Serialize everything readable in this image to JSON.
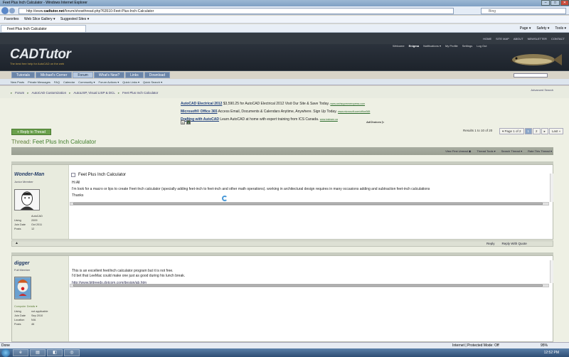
{
  "window": {
    "title": "Feet Plus Inch Calculator - Windows Internet Explorer",
    "address_prefix": "http://www.",
    "address_domain": "cadtutor.net",
    "address_path": "/forum/showthread.php?63510-Feet-Plus-Inch-Calculator",
    "search_placeholder": "Bing"
  },
  "favorites_bar": {
    "favorites": "Favorites",
    "web_slice": "Web Slice Gallery ▾",
    "suggested": "Suggested Sites ▾"
  },
  "tab": {
    "label": "Feet Plus Inch Calculator"
  },
  "command_bar": [
    "Page ▾",
    "Safety ▾",
    "Tools ▾"
  ],
  "site": {
    "top_links": [
      "HOME",
      "SITE MAP",
      "ABOUT",
      "NEWSLETTER",
      "CONTACT"
    ],
    "logo": "CADTutor",
    "tagline": "The best free help for AutoCAD on the web",
    "welcome": "Welcome",
    "user": "Enigma",
    "user_links": [
      "Notifications ▾",
      "My Profile",
      "Settings",
      "Log Out"
    ],
    "nav_tabs": [
      "Tutorials",
      "Michael's Corner",
      "Forum",
      "What's New?",
      "Links",
      "Download"
    ],
    "sub_nav": [
      "New Posts",
      "Private Messages",
      "FAQ",
      "Calendar",
      "Community ▾",
      "Forum Actions ▾",
      "Quick Links ▾",
      "Quick Search ▾"
    ],
    "advanced_search": "Advanced Search"
  },
  "breadcrumb": [
    "Forum",
    "AutoCAD Customization",
    "AutoLISP, Visual LISP & DCL",
    "Feet Plus Inch Calculator"
  ],
  "ads": [
    {
      "title": "AutoCAD Electrical 2012",
      "text": " $3,590.25 for AutoCAD Electrical 2012 Visit Our Site & Save Today.",
      "url": "www.archsupremeexpress.com"
    },
    {
      "title": "Microsoft® Office 365",
      "text": " Access Email, Documents & Calendars Anytime, Anywhere. Sign Up Today.",
      "url": "www.microsoft.com/office365"
    },
    {
      "title": "Drafting with AutoCAD",
      "text": " Learn AutoCAD at home with expert training from ICS Canada.",
      "url": "www.icslearn.ca"
    }
  ],
  "ad_nav": [
    "<",
    ">"
  ],
  "ad_choices": "AdChoices ▷",
  "reply_button": "+ Reply to Thread",
  "results": "Results 1 to 10 of 20",
  "pagination": [
    "▾ Page 1 of 2",
    "1",
    "2",
    "▸",
    "Last »"
  ],
  "thread": {
    "prefix": "Thread: ",
    "title": "Feet Plus Inch Calculator"
  },
  "thread_tools": [
    "View First Unread ◉",
    "Thread Tools ▾",
    "Search Thread ▾",
    "Rate This Thread ▾"
  ],
  "posts": [
    {
      "username": "Wonder-Man",
      "user_title": "Junior Member",
      "info": [
        [
          "Using",
          "AutoCAD 2009"
        ],
        [
          "Join Date",
          "Oct 2011"
        ],
        [
          "Posts",
          "12"
        ]
      ],
      "title": "Feet Plus Inch Calculator",
      "lines": [
        "Hi All",
        "I'm look for a macro or lips to create Feet-Inch calculator (specially adding feet-inch to feet-inch and other math operations). working in architectural design requires in many occasions adding and subtraction feet-inch calculations",
        "Thanks"
      ],
      "footer": [
        "Reply",
        "Reply With Quote"
      ]
    },
    {
      "username": "digger",
      "user_title": "Full Member",
      "computer_details": "Computer Details ▾",
      "info": [
        [
          "Using",
          "not applicable"
        ],
        [
          "Join Date",
          "Sep 2010"
        ],
        [
          "Location",
          "N/A"
        ],
        [
          "Posts",
          "46"
        ]
      ],
      "lines": [
        "This is an excellent feet/inch calculator program but it is not free.",
        "I'd bet that LeeMac could make one just as good during his lunch break.",
        "http://www.bittreeds.dotcom.com/design/ab.htm"
      ]
    }
  ],
  "status": {
    "zone": "Internet | Protected Mode: Off",
    "zoom": "95%"
  },
  "taskbar": {
    "clock": "12:52 PM"
  }
}
